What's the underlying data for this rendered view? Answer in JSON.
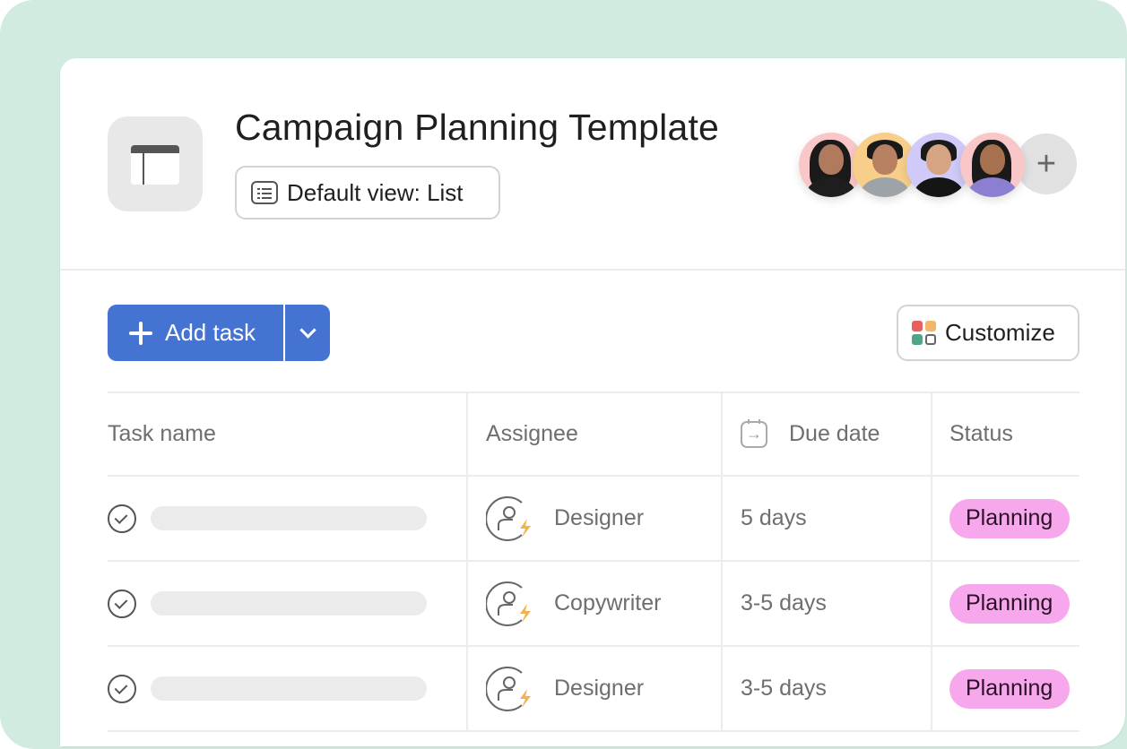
{
  "project": {
    "title": "Campaign Planning Template",
    "default_view_label": "Default view: List",
    "icon": "project-window-icon"
  },
  "members": {
    "avatars": [
      {
        "name": "member-1",
        "bg": "#f9c7c7"
      },
      {
        "name": "member-2",
        "bg": "#f7ce8a"
      },
      {
        "name": "member-3",
        "bg": "#cfcaf7"
      },
      {
        "name": "member-4",
        "bg": "#f9c7c7"
      }
    ],
    "add_label": "+"
  },
  "toolbar": {
    "add_task_label": "Add task",
    "customize_label": "Customize",
    "customize_colors": [
      "#ea5f5f",
      "#f2b766",
      "#4fa587",
      "#666666"
    ]
  },
  "table": {
    "columns": [
      "Task name",
      "Assignee",
      "Due date",
      "Status"
    ],
    "rows": [
      {
        "assignee": "Designer",
        "due": "5 days",
        "status": "Planning"
      },
      {
        "assignee": "Copywriter",
        "due": "3-5 days",
        "status": "Planning"
      },
      {
        "assignee": "Designer",
        "due": "3-5 days",
        "status": "Planning"
      }
    ]
  },
  "colors": {
    "accent": "#4573d2",
    "status_planning": "#f7a8ec",
    "backdrop": "#d1ebe0",
    "assignee_bolt": "#f2b24f"
  }
}
